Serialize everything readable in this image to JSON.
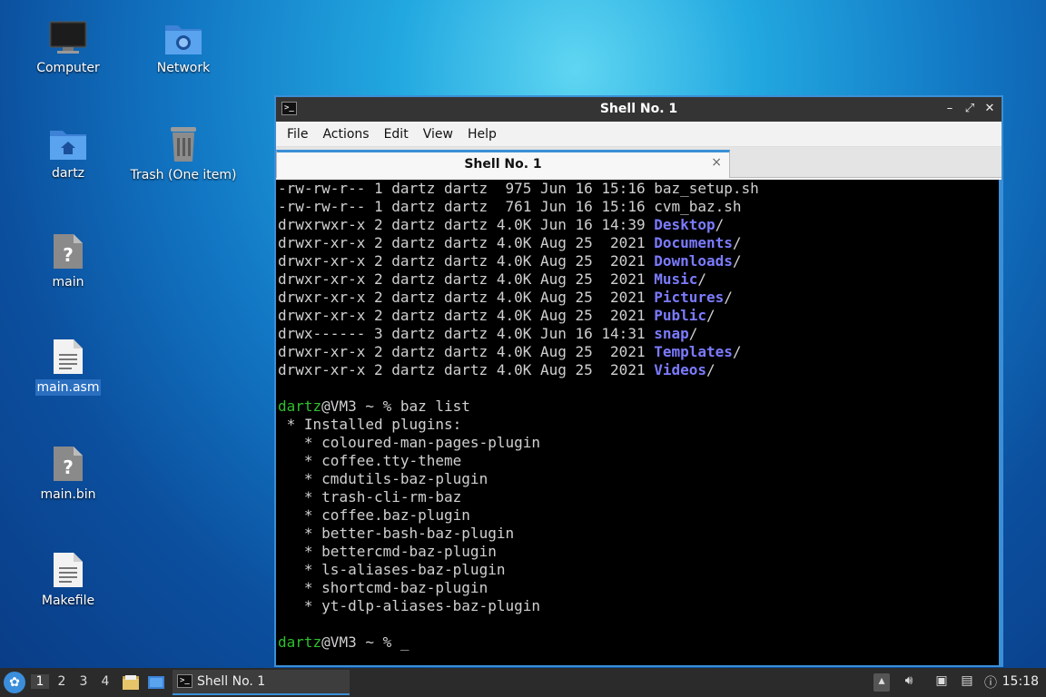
{
  "desktop": {
    "icons": [
      {
        "label": "Computer"
      },
      {
        "label": "Network"
      },
      {
        "label": "dartz"
      },
      {
        "label": "Trash (One item)"
      },
      {
        "label": "main"
      },
      {
        "label": "main.asm"
      },
      {
        "label": "main.bin"
      },
      {
        "label": "Makefile"
      }
    ]
  },
  "window": {
    "title": "Shell No. 1",
    "minimize": "–",
    "maximize": "⤢",
    "close": "✕",
    "menu": [
      "File",
      "Actions",
      "Edit",
      "View",
      "Help"
    ],
    "tab": {
      "label": "Shell No. 1",
      "close": "×"
    }
  },
  "terminal": {
    "listing": [
      {
        "meta": "-rw-rw-r-- 1 dartz dartz  975 Jun 16 15:16 ",
        "name": "baz_setup.sh",
        "dir": false
      },
      {
        "meta": "-rw-rw-r-- 1 dartz dartz  761 Jun 16 15:16 ",
        "name": "cvm_baz.sh",
        "dir": false
      },
      {
        "meta": "drwxrwxr-x 2 dartz dartz 4.0K Jun 16 14:39 ",
        "name": "Desktop",
        "dir": true
      },
      {
        "meta": "drwxr-xr-x 2 dartz dartz 4.0K Aug 25  2021 ",
        "name": "Documents",
        "dir": true
      },
      {
        "meta": "drwxr-xr-x 2 dartz dartz 4.0K Aug 25  2021 ",
        "name": "Downloads",
        "dir": true
      },
      {
        "meta": "drwxr-xr-x 2 dartz dartz 4.0K Aug 25  2021 ",
        "name": "Music",
        "dir": true
      },
      {
        "meta": "drwxr-xr-x 2 dartz dartz 4.0K Aug 25  2021 ",
        "name": "Pictures",
        "dir": true
      },
      {
        "meta": "drwxr-xr-x 2 dartz dartz 4.0K Aug 25  2021 ",
        "name": "Public",
        "dir": true
      },
      {
        "meta": "drwx------ 3 dartz dartz 4.0K Jun 16 14:31 ",
        "name": "snap",
        "dir": true
      },
      {
        "meta": "drwxr-xr-x 2 dartz dartz 4.0K Aug 25  2021 ",
        "name": "Templates",
        "dir": true
      },
      {
        "meta": "drwxr-xr-x 2 dartz dartz 4.0K Aug 25  2021 ",
        "name": "Videos",
        "dir": true
      }
    ],
    "prompt_user": "dartz",
    "prompt_rest": "@VM3 ~ % ",
    "command": "baz list",
    "plugins_header": " * Installed plugins:",
    "plugins": [
      "coloured-man-pages-plugin",
      "coffee.tty-theme",
      "cmdutils-baz-plugin",
      "trash-cli-rm-baz",
      "coffee.baz-plugin",
      "better-bash-baz-plugin",
      "bettercmd-baz-plugin",
      "ls-aliases-baz-plugin",
      "shortcmd-baz-plugin",
      "yt-dlp-aliases-baz-plugin"
    ],
    "cursor": "_"
  },
  "taskbar": {
    "workspaces": [
      "1",
      "2",
      "3",
      "4"
    ],
    "task_label": "Shell No. 1",
    "clock": "15:18"
  }
}
